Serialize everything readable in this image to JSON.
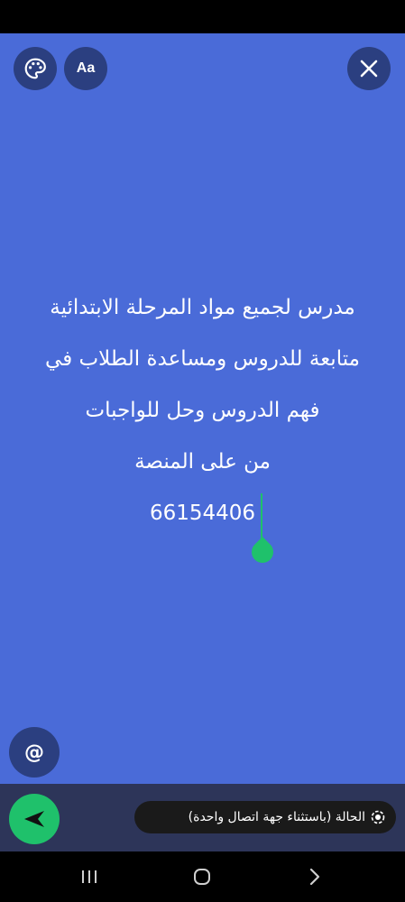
{
  "status_lines": [
    "مدرس لجميع مواد المرحلة الابتدائية",
    "متابعة للدروس ومساعدة الطلاب في",
    "فهم الدروس وحل للواجبات",
    "من على المنصة",
    "66154406"
  ],
  "font_button_label": "Aa",
  "mention_label": "@",
  "privacy_label": "الحالة (باستثناء جهة اتصال واحدة)",
  "colors": {
    "background": "#4A6BD8",
    "button": "#2B3F80",
    "accent": "#1FC16B",
    "bottom_bar": "#2D3559"
  }
}
